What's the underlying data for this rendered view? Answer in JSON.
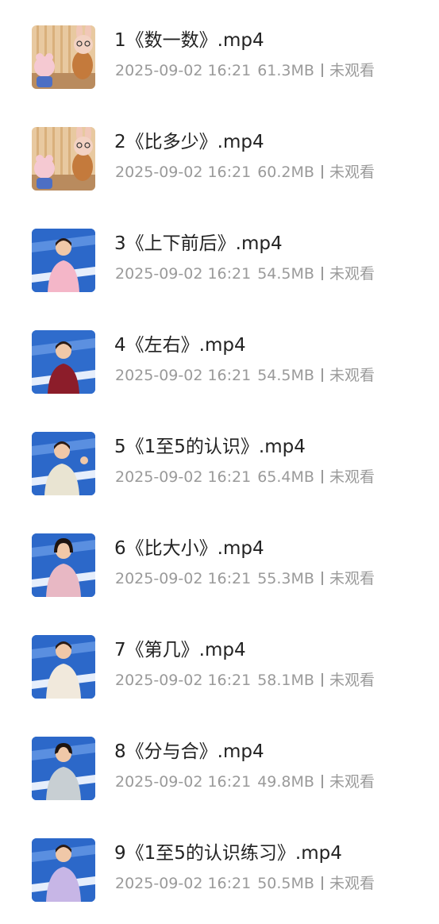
{
  "files": [
    {
      "name": "1《数一数》.mp4",
      "date": "2025-09-02 16:21",
      "size": "61.3MB",
      "status": "未观看",
      "thumbnail": "cartoon-rabbit-icon"
    },
    {
      "name": "2《比多少》.mp4",
      "date": "2025-09-02 16:21",
      "size": "60.2MB",
      "status": "未观看",
      "thumbnail": "cartoon-rabbit-icon"
    },
    {
      "name": "3《上下前后》.mp4",
      "date": "2025-09-02 16:21",
      "size": "54.5MB",
      "status": "未观看",
      "thumbnail": "teacher-video-icon"
    },
    {
      "name": "4《左右》.mp4",
      "date": "2025-09-02 16:21",
      "size": "54.5MB",
      "status": "未观看",
      "thumbnail": "teacher-video-icon"
    },
    {
      "name": "5《1至5的认识》.mp4",
      "date": "2025-09-02 16:21",
      "size": "65.4MB",
      "status": "未观看",
      "thumbnail": "teacher-video-icon"
    },
    {
      "name": "6《比大小》.mp4",
      "date": "2025-09-02 16:21",
      "size": "55.3MB",
      "status": "未观看",
      "thumbnail": "teacher-video-icon"
    },
    {
      "name": "7《第几》.mp4",
      "date": "2025-09-02 16:21",
      "size": "58.1MB",
      "status": "未观看",
      "thumbnail": "teacher-video-icon"
    },
    {
      "name": "8《分与合》.mp4",
      "date": "2025-09-02 16:21",
      "size": "49.8MB",
      "status": "未观看",
      "thumbnail": "teacher-video-icon"
    },
    {
      "name": "9《1至5的认识练习》.mp4",
      "date": "2025-09-02 16:21",
      "size": "50.5MB",
      "status": "未观看",
      "thumbnail": "teacher-video-icon"
    }
  ],
  "colors": {
    "title": "#222222",
    "meta": "#9a9a9a",
    "thumb_studio_blue": "#2c68c9"
  }
}
